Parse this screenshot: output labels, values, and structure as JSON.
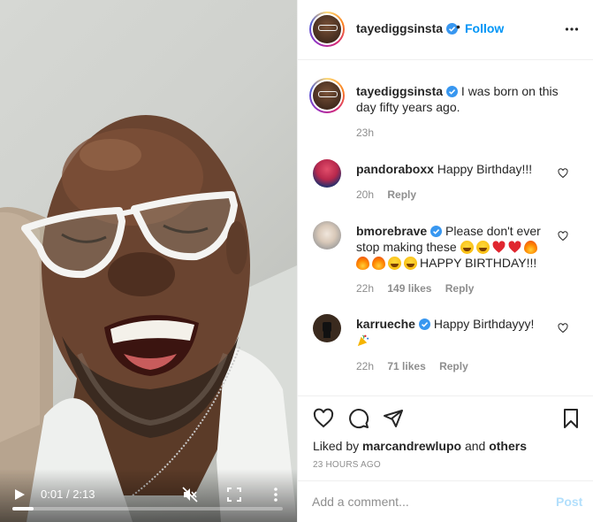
{
  "video": {
    "current_time": "0:01",
    "separator": "/",
    "duration": "2:13",
    "progress": 0.01
  },
  "post": {
    "author": "tayediggsinsta",
    "follow_label": "Follow",
    "separator_dot": "•",
    "caption": "I was born on this day fifty years ago.",
    "caption_time": "23h"
  },
  "comments": [
    {
      "username": "pandoraboxx",
      "text": "Happy Birthday!!!",
      "time": "20h",
      "likes": "",
      "reply_label": "Reply"
    },
    {
      "username": "bmorebrave",
      "text_1": "Please don't ever stop making these",
      "text_2": "HAPPY BIRTHDAY!!!",
      "time": "22h",
      "likes": "149 likes",
      "reply_label": "Reply"
    },
    {
      "username": "karrueche",
      "text": "Happy Birthdayyy!",
      "time": "22h",
      "likes": "71 likes",
      "reply_label": "Reply"
    }
  ],
  "actions": {
    "liked_by_prefix": "Liked by",
    "liked_by_user": "marcandrewlupo",
    "liked_by_and": "and",
    "liked_by_others": "others",
    "posted_ago": "23 HOURS AGO"
  },
  "add_comment": {
    "placeholder": "Add a comment...",
    "post_label": "Post"
  },
  "icons": {
    "verified": "verified-badge-icon",
    "heart": "heart-icon",
    "comment": "comment-icon",
    "share": "share-icon",
    "save": "bookmark-icon"
  },
  "colors": {
    "accent": "#0095f6",
    "muted": "#8e8e8e",
    "post_disabled": "#b2dffc",
    "border": "#efefef"
  }
}
